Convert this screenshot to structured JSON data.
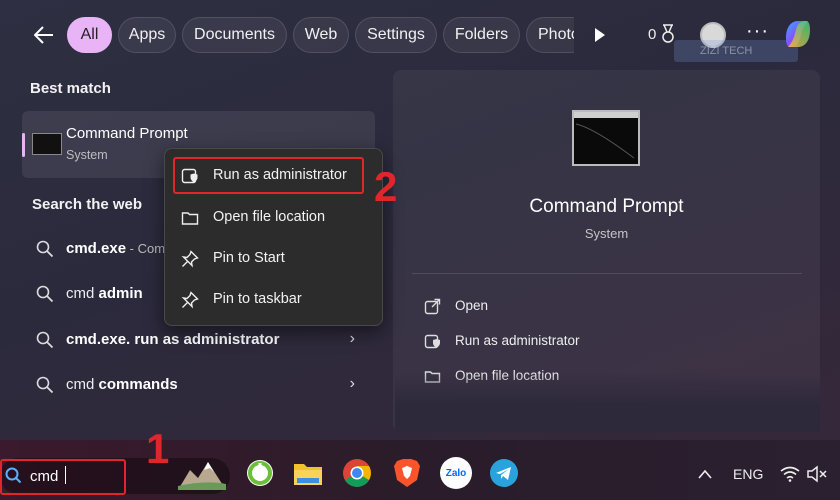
{
  "search": {
    "query": "cmd"
  },
  "filters": {
    "chips": [
      {
        "label": "All"
      },
      {
        "label": "Apps"
      },
      {
        "label": "Documents"
      },
      {
        "label": "Web"
      },
      {
        "label": "Settings"
      },
      {
        "label": "Folders"
      },
      {
        "label": "Photo"
      }
    ]
  },
  "header": {
    "rewards_count": "0",
    "more_label": "···",
    "watermark_text": "ZIZI TECH"
  },
  "best_match": {
    "heading": "Best match",
    "title": "Command Prompt",
    "subtitle": "System"
  },
  "web": {
    "heading": "Search the web",
    "results": [
      {
        "prefix": "cmd.exe",
        "suffix": " - Com",
        "bold": true
      },
      {
        "prefix": "cmd ",
        "bold_part": "admin"
      },
      {
        "prefix": "cmd.exe. run as administrator"
      },
      {
        "prefix": "cmd ",
        "bold_part": "commands"
      }
    ]
  },
  "context_menu": {
    "items": [
      {
        "label": "Run as administrator",
        "icon": "shield-icon"
      },
      {
        "label": "Open file location",
        "icon": "folder-icon"
      },
      {
        "label": "Pin to Start",
        "icon": "pin-icon"
      },
      {
        "label": "Pin to taskbar",
        "icon": "pin-icon"
      }
    ]
  },
  "preview": {
    "title": "Command Prompt",
    "subtitle": "System",
    "actions": [
      {
        "label": "Open",
        "icon": "open-external-icon"
      },
      {
        "label": "Run as administrator",
        "icon": "shield-icon"
      },
      {
        "label": "Open file location",
        "icon": "folder-icon"
      }
    ]
  },
  "annotations": {
    "step1": "1",
    "step2": "2"
  },
  "taskbar": {
    "language": "ENG",
    "zalo_label": "Zalo"
  },
  "colors": {
    "accent": "#e9b4f5",
    "annotation_red": "#e0262a"
  }
}
